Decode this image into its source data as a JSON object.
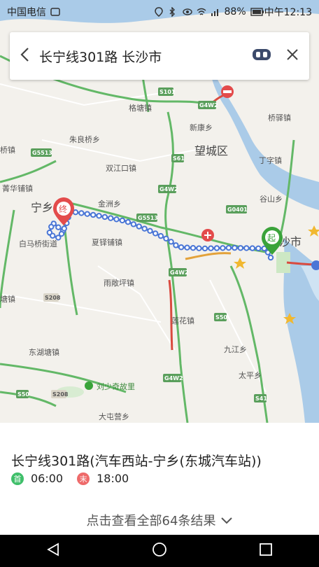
{
  "status": {
    "carrier": "中国电信",
    "battery": "88%",
    "clock": "中午12:13"
  },
  "search": {
    "title": "长宁线301路 长沙市"
  },
  "map": {
    "places": {
      "gaotangling": "格塘镇",
      "xinkangxiang": "新康乡",
      "qiaoyizhen": "桥驿镇",
      "zhuliangqiao": "朱良桥乡",
      "wangchengqu": "望城区",
      "dingzixiang": "丁字镇",
      "shuangjiangkou": "双江口镇",
      "qiaotou": "桥镇",
      "jingxiangpu": "菁华铺镇",
      "jinshanxiang": "金洲乡",
      "gushanxiang": "谷山乡",
      "ningxiang": "宁乡",
      "baimaqiao": "白马桥街道",
      "xiahuapu": "夏铎铺镇",
      "changsha": "沙市",
      "yuqiaopingzhen": "雨敞坪镇",
      "tangzhen": "塘镇",
      "lianhuazhen": "莲花镇",
      "donghutang": "东湖塘镇",
      "jiujiang": "九江乡",
      "taiping": "太平乡",
      "liushaoqi": "刘少奇故里",
      "dadunying": "大屯营乡"
    },
    "shields": {
      "s101": "S101",
      "g4w2a": "G4W2",
      "g5513a": "G5513",
      "s61": "S61",
      "g4w2b": "G4W2",
      "g0401": "G0401",
      "g5513b": "G5513",
      "g4w2c": "G4W2",
      "s50": "S50",
      "s208": "S208",
      "g4w2d": "G4W2",
      "s41": "S41",
      "s50b": "S50",
      "s208b": "S208",
      "s1": "S1"
    },
    "start_marker": "起",
    "end_marker": "终"
  },
  "route": {
    "name": "长宁线301路(汽车西站-宁乡(东城汽车站))",
    "first_badge": "首",
    "first_time": "06:00",
    "last_badge": "末",
    "last_time": "18:00",
    "more_results": "点击查看全部64条结果"
  },
  "colors": {
    "route_line": "#4a76d6",
    "start_green": "#3aa33a",
    "end_red": "#e34b4b",
    "highway_green": "#57b15a"
  }
}
